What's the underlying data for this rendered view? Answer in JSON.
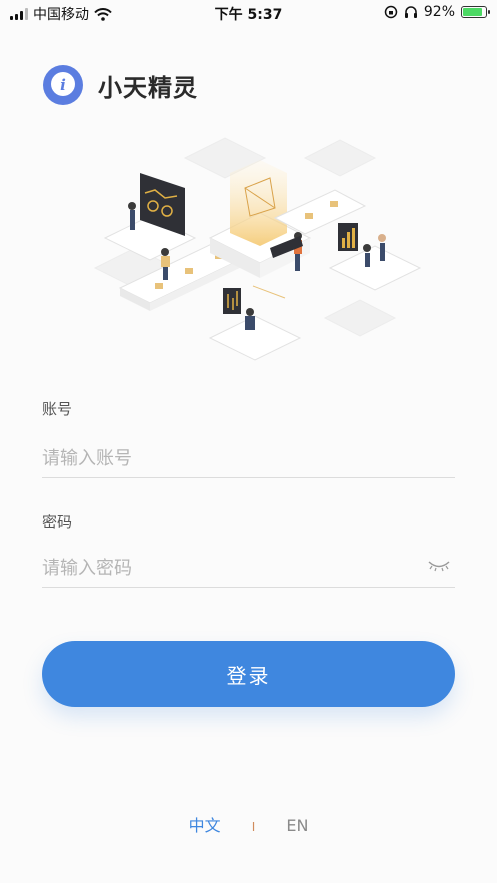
{
  "status": {
    "carrier": "中国移动",
    "time": "下午 5:37",
    "battery": "92%"
  },
  "app": {
    "name": "小天精灵",
    "logo_letter": "i"
  },
  "form": {
    "account_label": "账号",
    "account_placeholder": "请输入账号",
    "password_label": "密码",
    "password_placeholder": "请输入密码"
  },
  "login_label": "登录",
  "lang": {
    "zh": "中文",
    "separator": "I",
    "en": "EN"
  },
  "colors": {
    "accent": "#3f87df",
    "logo": "#5b7de0"
  }
}
